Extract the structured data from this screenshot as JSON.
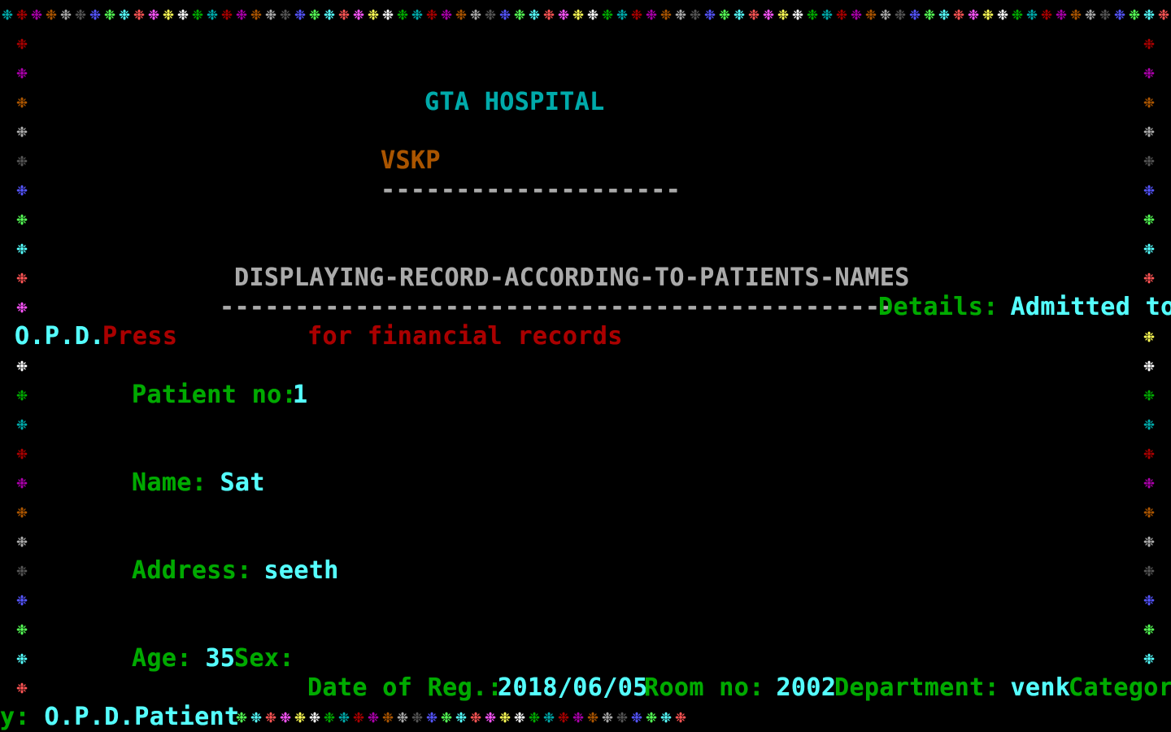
{
  "palette": [
    "#00aa00",
    "#00aaaa",
    "#aa0000",
    "#aa00aa",
    "#aa5500",
    "#aaaaaa",
    "#555555",
    "#5555ff",
    "#55ff55",
    "#55ffff",
    "#ff5555",
    "#ff55ff",
    "#ffff55",
    "#ffffff"
  ],
  "border": {
    "glyph": "❉",
    "row0_start": 1,
    "left_start": 1,
    "right_start": 1,
    "row24_start": 6
  },
  "header": {
    "hospital_name": "GTA HOSPITAL",
    "location": "VSKP",
    "underline": "--------------------",
    "view_title": "DISPLAYING-RECORD-ACCORDING-TO-PATIENTS-NAMES",
    "title_underline": "---------------------------------------------"
  },
  "details": {
    "label": "Details:",
    "value_line1": " Admitted to",
    "value_line2": "O.P.D."
  },
  "prompt": {
    "press": "Press",
    "financial": "for financial records"
  },
  "record": {
    "patient_no_label": "Patient no:",
    "patient_no": "1",
    "name_label": "Name:",
    "name": " Sat",
    "address_label": "Address:",
    "address": " seeth",
    "age_label": "Age:",
    "age": " 35",
    "sex_label": "Sex:",
    "date_label": "Date of Reg.:",
    "date": "2018/06/05",
    "room_label": "Room no:",
    "room": " 2002",
    "department_label": "Department:",
    "department": " venk",
    "category_label_line1": "Categor",
    "category_label_line2": "y:",
    "category": " O.P.D.Patient"
  },
  "colors": {
    "title": "#00aaaa",
    "location": "#aa5500",
    "view_title": "#aaaaaa",
    "label": "#00aa00",
    "value": "#55ffff",
    "prompt": "#aa0000"
  }
}
